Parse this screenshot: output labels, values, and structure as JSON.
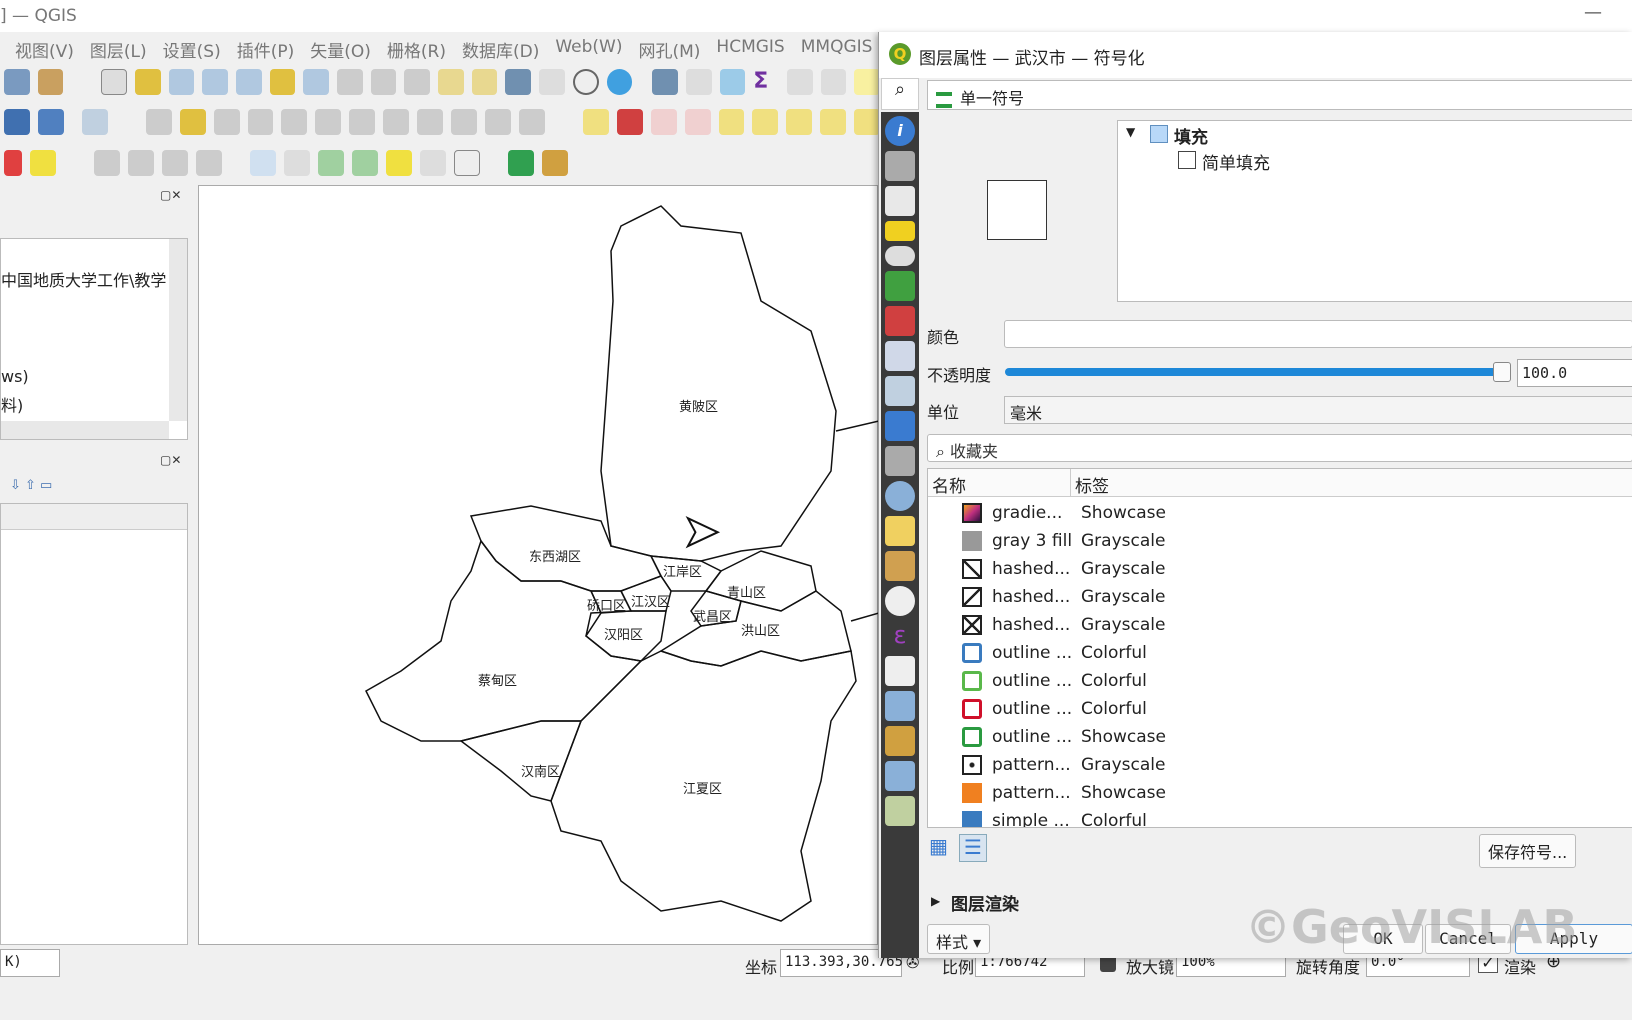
{
  "window": {
    "title": "] — QGIS"
  },
  "menu": [
    "视图(V)",
    "图层(L)",
    "设置(S)",
    "插件(P)",
    "矢量(O)",
    "栅格(R)",
    "数据库(D)",
    "Web(W)",
    "网孔(M)",
    "HCMGIS",
    "MMQGIS"
  ],
  "layers_panel": {
    "path": "中国地质大学工作\\教学",
    "item_a": "ws)",
    "item_b": "料)"
  },
  "map": {
    "districts": [
      "黄陂区",
      "东西湖区",
      "江岸区",
      "硚口区",
      "江汉区",
      "青山区",
      "武昌区",
      "汉阳区",
      "洪山区",
      "蔡甸区",
      "汉南区",
      "江夏区"
    ]
  },
  "status": {
    "coord_label": "坐标",
    "coord": "113.393,30.765",
    "scale_label": "比例",
    "scale": "1:766742",
    "magnifier_label": "放大镜",
    "magnifier": "100%",
    "rotation_label": "旋转角度",
    "rotation": "0.0°",
    "render_label": "渲染",
    "left_field": "K)"
  },
  "dialog": {
    "title": "图层属性 — 武汉市 — 符号化",
    "renderer": "单一符号",
    "tree": {
      "root": "填充",
      "child": "简单填充"
    },
    "color_label": "颜色",
    "opacity_label": "不透明度",
    "opacity": "100.0",
    "opacity_value": 100,
    "unit_label": "单位",
    "unit": "毫米",
    "search_placeholder": "收藏夹",
    "columns": {
      "name": "名称",
      "tag": "标签"
    },
    "symbols": [
      {
        "name": "gradie...",
        "tag": "Showcase",
        "icon": "gradient",
        "color": "#c03080"
      },
      {
        "name": "gray 3 fill",
        "tag": "Grayscale",
        "icon": "gray",
        "color": "#999999"
      },
      {
        "name": "hashed...",
        "tag": "Grayscale",
        "icon": "hash-fwd",
        "color": "#ffffff"
      },
      {
        "name": "hashed...",
        "tag": "Grayscale",
        "icon": "hash-back",
        "color": "#ffffff"
      },
      {
        "name": "hashed...",
        "tag": "Grayscale",
        "icon": "hash-cross",
        "color": "#ffffff"
      },
      {
        "name": "outline ...",
        "tag": "Colorful",
        "icon": "outline-blue",
        "color": "#3a7bbf"
      },
      {
        "name": "outline ...",
        "tag": "Colorful",
        "icon": "outline-green",
        "color": "#5ab84a"
      },
      {
        "name": "outline ...",
        "tag": "Colorful",
        "icon": "outline-red",
        "color": "#d0102a"
      },
      {
        "name": "outline ...",
        "tag": "Showcase",
        "icon": "outline-showcase",
        "color": "#2a9a40"
      },
      {
        "name": "pattern...",
        "tag": "Grayscale",
        "icon": "pattern-dot",
        "color": "#ffffff"
      },
      {
        "name": "pattern...",
        "tag": "Showcase",
        "icon": "pattern-orange",
        "color": "#f08020"
      },
      {
        "name": "simple ...",
        "tag": "Colorful",
        "icon": "simple-blue",
        "color": "#3a7bbf"
      }
    ],
    "save_symbol": "保存符号...",
    "layer_rendering": "图层渲染",
    "style_button": "样式",
    "ok": "OK",
    "cancel": "Cancel",
    "apply": "Apply",
    "watermark": "©GeoVISLAB"
  },
  "colors": {
    "accent": "#1e88d8",
    "sidebar": "#3a3a3a"
  }
}
